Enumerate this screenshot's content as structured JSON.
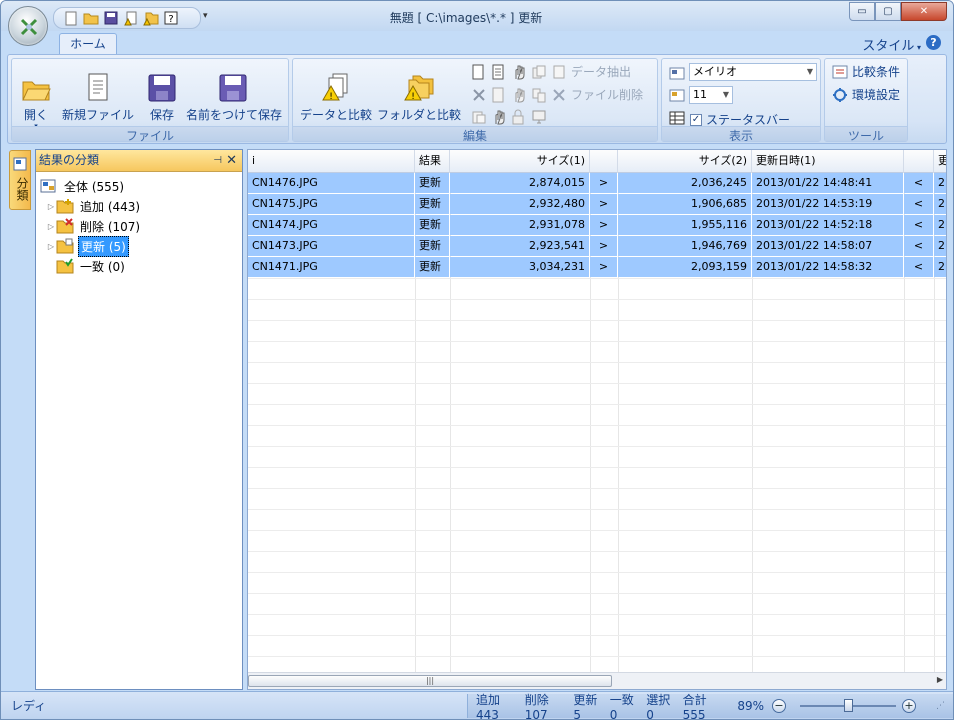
{
  "window": {
    "title": "無題 [ C:\\images\\*.* ] 更新",
    "minimize_label": "▭",
    "maximize_label": "▢",
    "close_label": "✕"
  },
  "tabs": {
    "home": "ホーム",
    "style": "スタイル",
    "help": "?"
  },
  "ribbon": {
    "file": {
      "label": "ファイル",
      "open": "開く",
      "new": "新規ファイル",
      "save": "保存",
      "save_as": "名前をつけて保存"
    },
    "edit": {
      "label": "編集",
      "compare_data": "データと比較",
      "compare_folder": "フォルダと比較",
      "extract": "データ抽出",
      "delete_file": "ファイル削除"
    },
    "view": {
      "label": "表示",
      "font_name": "メイリオ",
      "font_size": "11",
      "statusbar": "ステータスバー"
    },
    "tools": {
      "label": "ツール",
      "compare_conditions": "比較条件",
      "settings": "環境設定"
    }
  },
  "side_tab": "分類",
  "panel": {
    "title": "結果の分類",
    "pin": "ᵖ",
    "close": "✕",
    "tree": [
      {
        "label": "全体 (555)",
        "expandable": false,
        "selected": false
      },
      {
        "label": "追加 (443)",
        "expandable": true,
        "selected": false
      },
      {
        "label": "削除 (107)",
        "expandable": true,
        "selected": false
      },
      {
        "label": "更新 (5)",
        "expandable": true,
        "selected": true
      },
      {
        "label": "一致 (0)",
        "expandable": false,
        "selected": false
      }
    ]
  },
  "grid": {
    "headers": [
      "i",
      "結果",
      "サイズ(1)",
      "",
      "サイズ(2)",
      "更新日時(1)",
      "",
      "更"
    ],
    "rows": [
      {
        "name": "CN1476.JPG",
        "result": "更新",
        "size1": "2,874,015",
        "op1": ">",
        "size2": "2,036,245",
        "date1": "2013/01/22 14:48:41",
        "op2": "<",
        "tail": "2"
      },
      {
        "name": "CN1475.JPG",
        "result": "更新",
        "size1": "2,932,480",
        "op1": ">",
        "size2": "1,906,685",
        "date1": "2013/01/22 14:53:19",
        "op2": "<",
        "tail": "2"
      },
      {
        "name": "CN1474.JPG",
        "result": "更新",
        "size1": "2,931,078",
        "op1": ">",
        "size2": "1,955,116",
        "date1": "2013/01/22 14:52:18",
        "op2": "<",
        "tail": "2"
      },
      {
        "name": "CN1473.JPG",
        "result": "更新",
        "size1": "2,923,541",
        "op1": ">",
        "size2": "1,946,769",
        "date1": "2013/01/22 14:58:07",
        "op2": "<",
        "tail": "2"
      },
      {
        "name": "CN1471.JPG",
        "result": "更新",
        "size1": "3,034,231",
        "op1": ">",
        "size2": "2,093,159",
        "date1": "2013/01/22 14:58:32",
        "op2": "<",
        "tail": "2"
      }
    ]
  },
  "status": {
    "ready": "レディ",
    "added": "追加 443",
    "deleted": "削除 107",
    "updated": "更新 5",
    "match": "一致 0",
    "selected": "選択 0",
    "total": "合計 555",
    "zoom": "89%",
    "zoom_out": "−",
    "zoom_in": "+"
  },
  "colors": {
    "selection": "#9ec9ff",
    "tree_selection": "#3399ff",
    "ribbon_text": "#15428b",
    "panel_header": "#f6c75e"
  }
}
